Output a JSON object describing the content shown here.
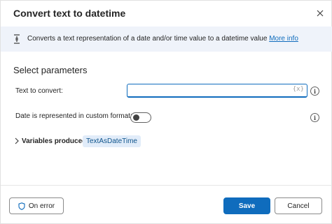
{
  "dialog": {
    "title": "Convert text to datetime"
  },
  "info": {
    "text": "Converts a text representation of a date and/or time value to a datetime value",
    "link": "More info"
  },
  "parameters": {
    "section_title": "Select parameters",
    "text_to_convert": {
      "label": "Text to convert:",
      "value": "",
      "variable_button": "{x}"
    },
    "custom_format": {
      "label": "Date is represented in custom format:",
      "enabled": false
    },
    "help_glyph": "i"
  },
  "variables": {
    "label": "Variables produced",
    "items": [
      "TextAsDateTime"
    ]
  },
  "footer": {
    "on_error_label": "On error",
    "save_label": "Save",
    "cancel_label": "Cancel"
  },
  "colors": {
    "accent": "#0f6cbd",
    "banner_bg": "#eff3fa",
    "chip_bg": "#e1ecf9"
  }
}
